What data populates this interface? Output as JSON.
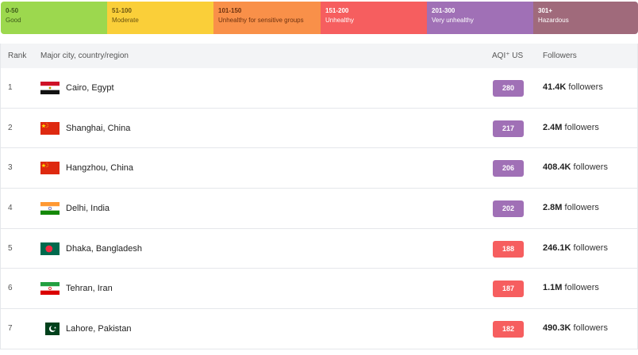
{
  "legend": [
    {
      "range": "0-50",
      "label": "Good",
      "color": "#9cd84e",
      "text_color": "#3d5a1a"
    },
    {
      "range": "51-100",
      "label": "Moderate",
      "color": "#facf39",
      "text_color": "#6b5410"
    },
    {
      "range": "101-150",
      "label": "Unhealthy for sensitive groups",
      "color": "#f99049",
      "text_color": "#6e3210"
    },
    {
      "range": "151-200",
      "label": "Unhealthy",
      "color": "#f65e5f",
      "text_color": "#ffffff"
    },
    {
      "range": "201-300",
      "label": "Very unhealthy",
      "color": "#a070b6",
      "text_color": "#ffffff"
    },
    {
      "range": "301+",
      "label": "Hazardous",
      "color": "#a06a7b",
      "text_color": "#ffffff"
    }
  ],
  "table": {
    "headers": {
      "rank": "Rank",
      "city": "Major city, country/region",
      "aqi": "AQI⁺ US",
      "followers": "Followers"
    },
    "rows": [
      {
        "rank": "1",
        "city": "Cairo, Egypt",
        "aqi": "280",
        "aqi_color": "#a070b6",
        "followers_count": "41.4K",
        "followers_suffix": "followers",
        "flag": "egypt-flag-icon"
      },
      {
        "rank": "2",
        "city": "Shanghai, China",
        "aqi": "217",
        "aqi_color": "#a070b6",
        "followers_count": "2.4M",
        "followers_suffix": "followers",
        "flag": "china-flag-icon"
      },
      {
        "rank": "3",
        "city": "Hangzhou, China",
        "aqi": "206",
        "aqi_color": "#a070b6",
        "followers_count": "408.4K",
        "followers_suffix": "followers",
        "flag": "china-flag-icon"
      },
      {
        "rank": "4",
        "city": "Delhi, India",
        "aqi": "202",
        "aqi_color": "#a070b6",
        "followers_count": "2.8M",
        "followers_suffix": "followers",
        "flag": "india-flag-icon"
      },
      {
        "rank": "5",
        "city": "Dhaka, Bangladesh",
        "aqi": "188",
        "aqi_color": "#f65e5f",
        "followers_count": "246.1K",
        "followers_suffix": "followers",
        "flag": "bangladesh-flag-icon"
      },
      {
        "rank": "6",
        "city": "Tehran, Iran",
        "aqi": "187",
        "aqi_color": "#f65e5f",
        "followers_count": "1.1M",
        "followers_suffix": "followers",
        "flag": "iran-flag-icon"
      },
      {
        "rank": "7",
        "city": "Lahore, Pakistan",
        "aqi": "182",
        "aqi_color": "#f65e5f",
        "followers_count": "490.3K",
        "followers_suffix": "followers",
        "flag": "pakistan-flag-icon"
      }
    ]
  }
}
